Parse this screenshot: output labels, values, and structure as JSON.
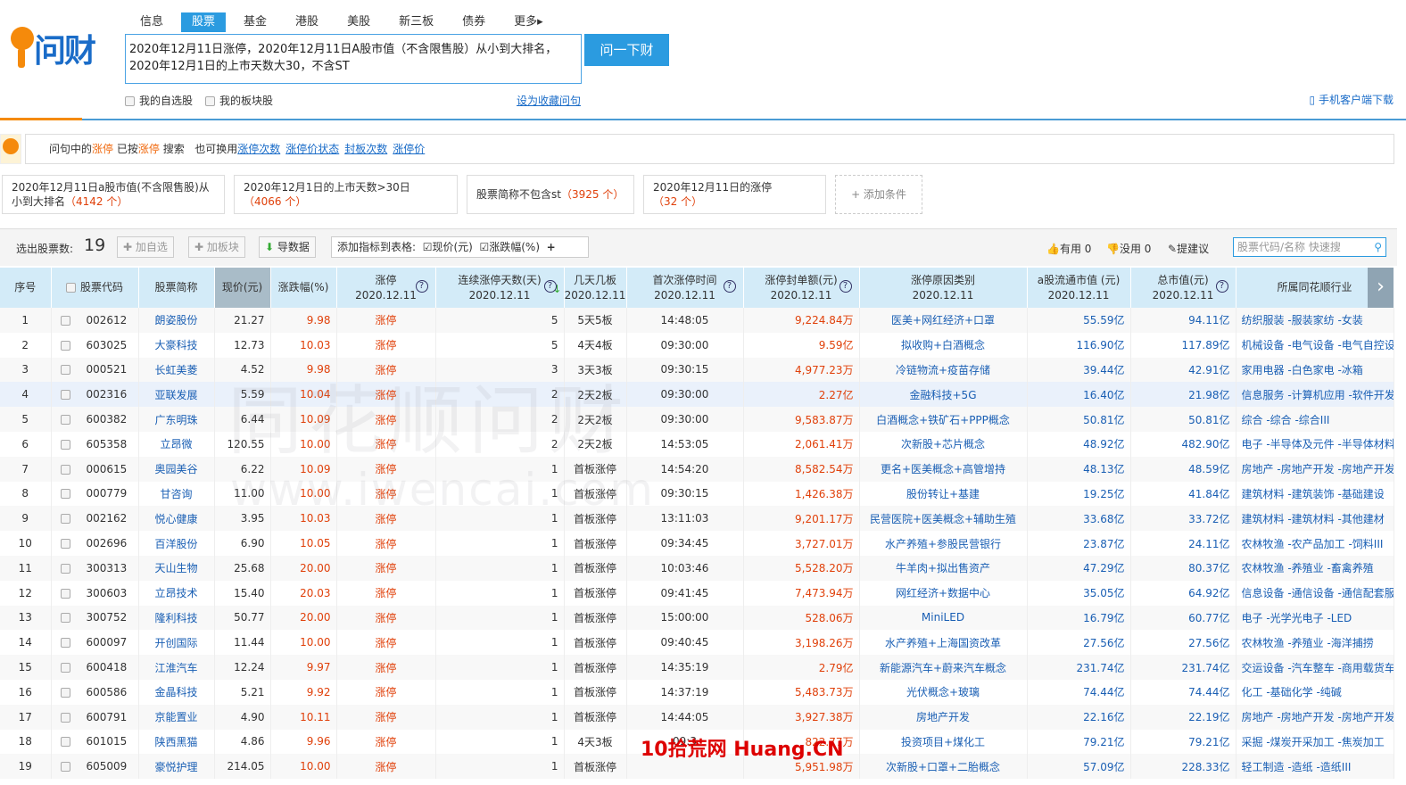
{
  "brand": "问财",
  "nav": [
    "信息",
    "股票",
    "基金",
    "港股",
    "美股",
    "新三板",
    "债券",
    "更多▸"
  ],
  "query": "2020年12月11日涨停，2020年12月11日A股市值（不含限售股）从小到大排名，2020年12月1日的上市天数大30，不含ST",
  "ask_label": "问一下财",
  "opt_watch": "我的自选股",
  "opt_sector": "我的板块股",
  "fav_link": "设为收藏问句",
  "mobile_link": "手机客户端下载",
  "hint": {
    "p1": "问句中的",
    "k1": "涨停",
    "p2": "已按",
    "k2": "涨停",
    "p3": "搜索",
    "p4": "也可换用",
    "links": [
      "涨停次数",
      "涨停价状态",
      "封板次数",
      "涨停价"
    ]
  },
  "conditions": [
    {
      "text": "2020年12月11日a股市值(不含限售股)从小到大排名",
      "count": "（4142 个）"
    },
    {
      "text": "2020年12月1日的上市天数>30日",
      "count": "（4066 个）"
    },
    {
      "text": "股票简称不包含st",
      "count": "（3925 个）"
    },
    {
      "text": "2020年12月11日的涨停",
      "count": "（32 个）"
    }
  ],
  "add_condition": "+ 添加条件",
  "toolbar": {
    "count_label": "选出股票数:",
    "count": "19",
    "add_watch": "✚ 加自选",
    "add_sector": "✚ 加板块",
    "export": "导数据",
    "add_ind": "添加指标到表格:",
    "ind1": "现价(元)",
    "ind2": "涨跌幅(%)",
    "plus": "+",
    "useful": "有用 0",
    "useless": "没用 0",
    "suggest": "提建议",
    "search_ph": "股票代码/名称 快速搜"
  },
  "columns": [
    "序号",
    "股票代码",
    "股票简称",
    "现价(元)",
    "涨跌幅(%)",
    "涨停",
    "连续涨停天数(天)",
    "几天几板",
    "首次涨停时间",
    "涨停封单额(元)",
    "涨停原因类别",
    "a股流通市值 (元)",
    "总市值(元)",
    "所属同花顺行业"
  ],
  "col_date": "2020.12.11",
  "watermark": "同花顺问财",
  "watermark2": "www.iwencai.com",
  "watermark3": "10拾荒网 Huang.CN",
  "rows": [
    [
      "1",
      "002612",
      "朗姿股份",
      "21.27",
      "9.98",
      "涨停",
      "5",
      "5天5板",
      "14:48:05",
      "9,224.84万",
      "医美+网红经济+口罩",
      "55.59亿",
      "94.11亿",
      "纺织服装 -服装家纺 -女装"
    ],
    [
      "2",
      "603025",
      "大豪科技",
      "12.73",
      "10.03",
      "涨停",
      "5",
      "4天4板",
      "09:30:00",
      "9.59亿",
      "拟收购+白酒概念",
      "116.90亿",
      "117.89亿",
      "机械设备 -电气设备 -电气自控设备"
    ],
    [
      "3",
      "000521",
      "长虹美菱",
      "4.52",
      "9.98",
      "涨停",
      "3",
      "3天3板",
      "09:30:15",
      "4,977.23万",
      "冷链物流+疫苗存储",
      "39.44亿",
      "42.91亿",
      "家用电器 -白色家电 -冰箱"
    ],
    [
      "4",
      "002316",
      "亚联发展",
      "5.59",
      "10.04",
      "涨停",
      "2",
      "2天2板",
      "09:30:00",
      "2.27亿",
      "金融科技+5G",
      "16.40亿",
      "21.98亿",
      "信息服务 -计算机应用 -软件开发"
    ],
    [
      "5",
      "600382",
      "广东明珠",
      "6.44",
      "10.09",
      "涨停",
      "2",
      "2天2板",
      "09:30:00",
      "9,583.87万",
      "白酒概念+铁矿石+PPP概念",
      "50.81亿",
      "50.81亿",
      "综合 -综合 -综合III"
    ],
    [
      "6",
      "605358",
      "立昂微",
      "120.55",
      "10.00",
      "涨停",
      "2",
      "2天2板",
      "14:53:05",
      "2,061.41万",
      "次新股+芯片概念",
      "48.92亿",
      "482.90亿",
      "电子 -半导体及元件 -半导体材料"
    ],
    [
      "7",
      "000615",
      "奥园美谷",
      "6.22",
      "10.09",
      "涨停",
      "1",
      "首板涨停",
      "14:54:20",
      "8,582.54万",
      "更名+医美概念+高管增持",
      "48.13亿",
      "48.59亿",
      "房地产 -房地产开发 -房地产开发II"
    ],
    [
      "8",
      "000779",
      "甘咨询",
      "11.00",
      "10.00",
      "涨停",
      "1",
      "首板涨停",
      "09:30:15",
      "1,426.38万",
      "股份转让+基建",
      "19.25亿",
      "41.84亿",
      "建筑材料 -建筑装饰 -基础建设"
    ],
    [
      "9",
      "002162",
      "悦心健康",
      "3.95",
      "10.03",
      "涨停",
      "1",
      "首板涨停",
      "13:11:03",
      "9,201.17万",
      "民营医院+医美概念+辅助生殖",
      "33.68亿",
      "33.72亿",
      "建筑材料 -建筑材料 -其他建材"
    ],
    [
      "10",
      "002696",
      "百洋股份",
      "6.90",
      "10.05",
      "涨停",
      "1",
      "首板涨停",
      "09:34:45",
      "3,727.01万",
      "水产养殖+参股民营银行",
      "23.87亿",
      "24.11亿",
      "农林牧渔 -农产品加工 -饲料III"
    ],
    [
      "11",
      "300313",
      "天山生物",
      "25.68",
      "20.00",
      "涨停",
      "1",
      "首板涨停",
      "10:03:46",
      "5,528.20万",
      "牛羊肉+拟出售资产",
      "47.29亿",
      "80.37亿",
      "农林牧渔 -养殖业 -畜禽养殖"
    ],
    [
      "12",
      "300603",
      "立昂技术",
      "15.40",
      "20.03",
      "涨停",
      "1",
      "首板涨停",
      "09:41:45",
      "7,473.94万",
      "网红经济+数据中心",
      "35.05亿",
      "64.92亿",
      "信息设备 -通信设备 -通信配套服务"
    ],
    [
      "13",
      "300752",
      "隆利科技",
      "50.77",
      "20.00",
      "涨停",
      "1",
      "首板涨停",
      "15:00:00",
      "528.06万",
      "MiniLED",
      "16.79亿",
      "60.77亿",
      "电子 -光学光电子 -LED"
    ],
    [
      "14",
      "600097",
      "开创国际",
      "11.44",
      "10.00",
      "涨停",
      "1",
      "首板涨停",
      "09:40:45",
      "3,198.26万",
      "水产养殖+上海国资改革",
      "27.56亿",
      "27.56亿",
      "农林牧渔 -养殖业 -海洋捕捞"
    ],
    [
      "15",
      "600418",
      "江淮汽车",
      "12.24",
      "9.97",
      "涨停",
      "1",
      "首板涨停",
      "14:35:19",
      "2.79亿",
      "新能源汽车+蔚来汽车概念",
      "231.74亿",
      "231.74亿",
      "交运设备 -汽车整车 -商用载货车"
    ],
    [
      "16",
      "600586",
      "金晶科技",
      "5.21",
      "9.92",
      "涨停",
      "1",
      "首板涨停",
      "14:37:19",
      "5,483.73万",
      "光伏概念+玻璃",
      "74.44亿",
      "74.44亿",
      "化工 -基础化学 -纯碱"
    ],
    [
      "17",
      "600791",
      "京能置业",
      "4.90",
      "10.11",
      "涨停",
      "1",
      "首板涨停",
      "14:44:05",
      "3,927.38万",
      "房地产开发",
      "22.16亿",
      "22.19亿",
      "房地产 -房地产开发 -房地产开发II"
    ],
    [
      "18",
      "601015",
      "陕西黑猫",
      "4.86",
      "9.96",
      "涨停",
      "1",
      "4天3板",
      "09:3",
      "822.77万",
      "投资项目+煤化工",
      "79.21亿",
      "79.21亿",
      "采掘 -煤炭开采加工 -焦炭加工"
    ],
    [
      "19",
      "605009",
      "豪悦护理",
      "214.05",
      "10.00",
      "涨停",
      "1",
      "首板涨停",
      "",
      "5,951.98万",
      "次新股+口罩+二胎概念",
      "57.09亿",
      "228.33亿",
      "轻工制造 -造纸 -造纸III"
    ]
  ]
}
